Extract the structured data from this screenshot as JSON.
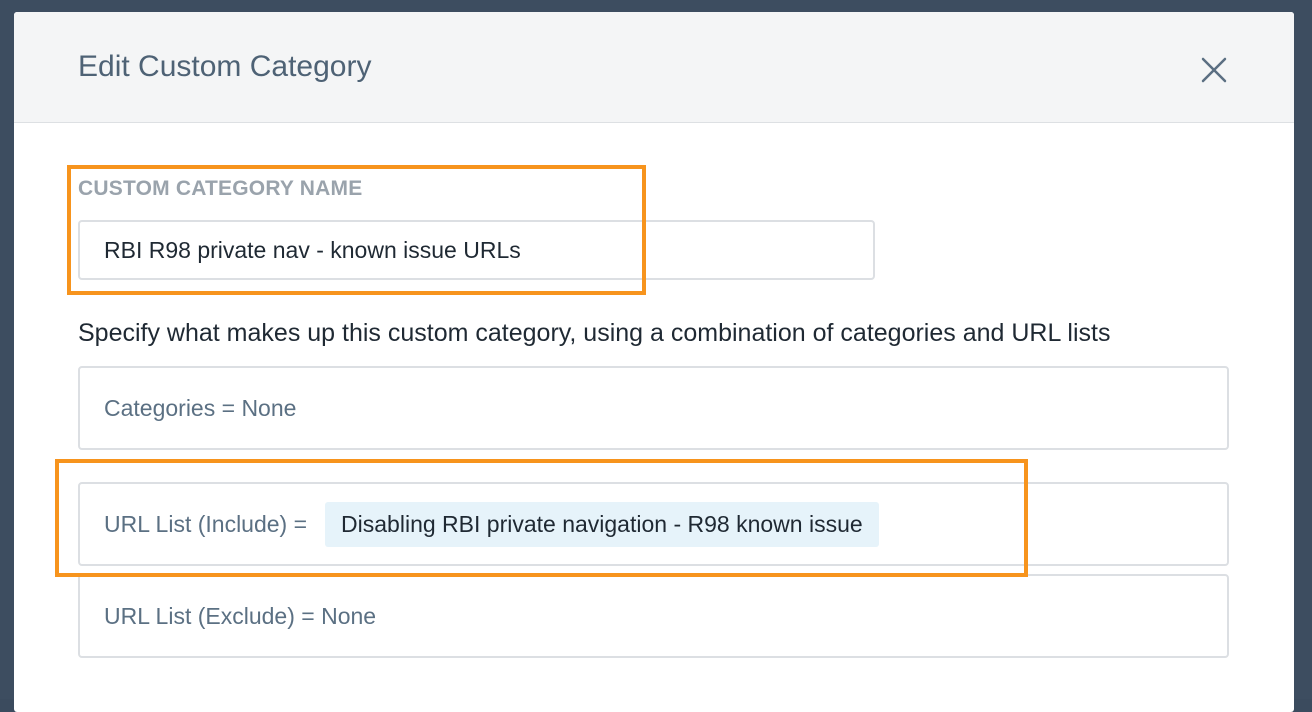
{
  "modal": {
    "title": "Edit Custom Category",
    "close_icon": "close-icon"
  },
  "form": {
    "name_label": "CUSTOM CATEGORY NAME",
    "name_value": "RBI R98 private nav - known issue URLs",
    "description": "Specify what makes up this custom category, using a combination of categories and URL lists"
  },
  "rules": {
    "categories": "Categories = None",
    "include_label": "URL List (Include) =",
    "include_chip": "Disabling RBI private navigation - R98 known issue",
    "exclude": "URL List (Exclude) = None"
  },
  "colors": {
    "highlight": "#f7941d",
    "chip_background": "#e6f3fa",
    "title": "#4e6275"
  }
}
